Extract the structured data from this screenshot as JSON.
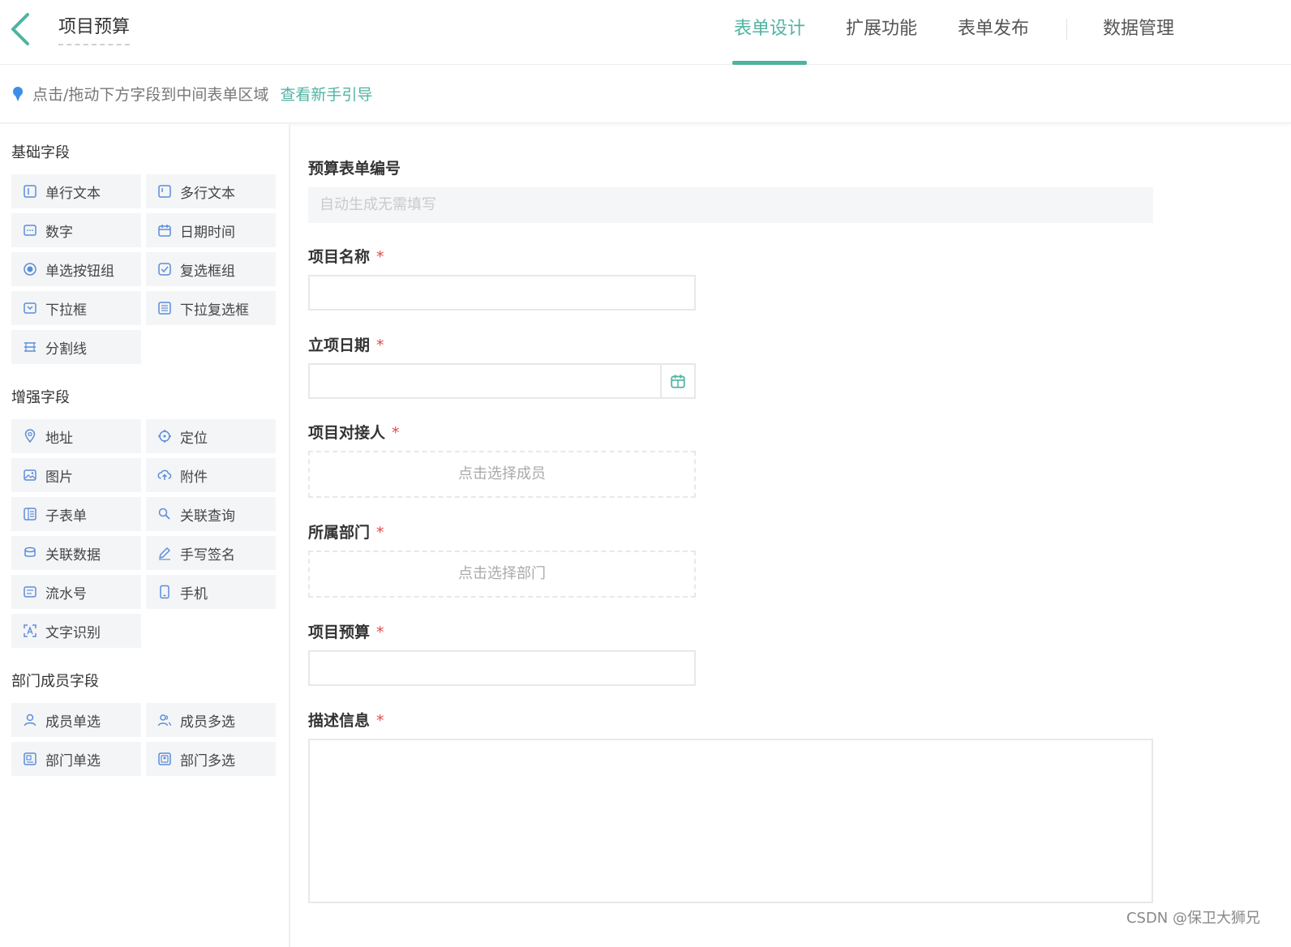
{
  "header": {
    "title": "项目预算",
    "tabs": [
      {
        "label": "表单设计",
        "active": true
      },
      {
        "label": "扩展功能",
        "active": false
      },
      {
        "label": "表单发布",
        "active": false
      },
      {
        "label": "数据管理",
        "active": false
      }
    ]
  },
  "hint": {
    "text": "点击/拖动下方字段到中间表单区域",
    "link": "查看新手引导"
  },
  "sidebar": {
    "groups": [
      {
        "title": "基础字段",
        "items": [
          {
            "label": "单行文本",
            "icon": "single-line-text-icon"
          },
          {
            "label": "多行文本",
            "icon": "multi-line-text-icon"
          },
          {
            "label": "数字",
            "icon": "number-icon"
          },
          {
            "label": "日期时间",
            "icon": "calendar-icon"
          },
          {
            "label": "单选按钮组",
            "icon": "radio-icon"
          },
          {
            "label": "复选框组",
            "icon": "checkbox-icon"
          },
          {
            "label": "下拉框",
            "icon": "dropdown-icon"
          },
          {
            "label": "下拉复选框",
            "icon": "dropdown-checklist-icon"
          },
          {
            "label": "分割线",
            "icon": "divider-icon"
          }
        ]
      },
      {
        "title": "增强字段",
        "items": [
          {
            "label": "地址",
            "icon": "location-pin-icon"
          },
          {
            "label": "定位",
            "icon": "crosshair-icon"
          },
          {
            "label": "图片",
            "icon": "image-icon"
          },
          {
            "label": "附件",
            "icon": "upload-cloud-icon"
          },
          {
            "label": "子表单",
            "icon": "subform-icon"
          },
          {
            "label": "关联查询",
            "icon": "linked-query-icon"
          },
          {
            "label": "关联数据",
            "icon": "linked-data-icon"
          },
          {
            "label": "手写签名",
            "icon": "pen-icon"
          },
          {
            "label": "流水号",
            "icon": "serial-number-icon"
          },
          {
            "label": "手机",
            "icon": "phone-icon"
          },
          {
            "label": "文字识别",
            "icon": "ocr-icon"
          }
        ]
      },
      {
        "title": "部门成员字段",
        "items": [
          {
            "label": "成员单选",
            "icon": "user-icon"
          },
          {
            "label": "成员多选",
            "icon": "users-icon"
          },
          {
            "label": "部门单选",
            "icon": "department-icon"
          },
          {
            "label": "部门多选",
            "icon": "departments-icon"
          }
        ]
      }
    ]
  },
  "form": {
    "fields": [
      {
        "label": "预算表单编号",
        "required": false,
        "placeholder": "自动生成无需填写"
      },
      {
        "label": "项目名称",
        "required": true
      },
      {
        "label": "立项日期",
        "required": true
      },
      {
        "label": "项目对接人",
        "required": true,
        "placeholder": "点击选择成员"
      },
      {
        "label": "所属部门",
        "required": true,
        "placeholder": "点击选择部门"
      },
      {
        "label": "项目预算",
        "required": true
      },
      {
        "label": "描述信息",
        "required": true
      }
    ],
    "required_mark": "*"
  },
  "watermark": "CSDN @保卫大狮兄",
  "colors": {
    "accent": "#4fb3a2",
    "required": "#e24a4a"
  }
}
